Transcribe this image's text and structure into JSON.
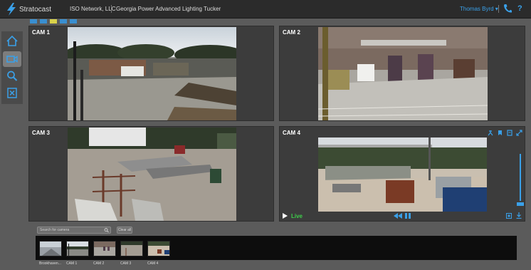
{
  "header": {
    "brand": "Stratocast",
    "organization": "ISO Network, LLC",
    "site": "Georgia Power Advanced Lighting Tucker",
    "user": "Thomas Byrd ▾",
    "help": "?",
    "accent": "#3aa0e8"
  },
  "layout_options": [
    "1x1",
    "2x1",
    "2x2",
    "3x3",
    "4x4"
  ],
  "nav": [
    "home-icon",
    "camera-icon",
    "search-icon",
    "close-box-icon"
  ],
  "cameras": [
    {
      "title": "CAM 1"
    },
    {
      "title": "CAM 2"
    },
    {
      "title": "CAM 3"
    },
    {
      "title": "CAM 4",
      "live_label": "Live"
    }
  ],
  "filmstrip": {
    "search_placeholder": "Search for camera",
    "clear_label": "Clear all",
    "thumbnails": [
      "Brookhaven...",
      "CAM 1",
      "CAM 2",
      "CAM 3",
      "CAM 4"
    ]
  }
}
